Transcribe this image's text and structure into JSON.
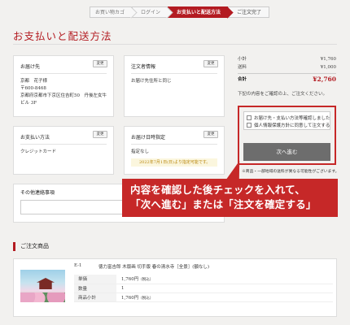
{
  "stepper": {
    "steps": [
      {
        "label": "お買い物カゴ"
      },
      {
        "label": "ログイン"
      },
      {
        "label": "お支払いと配送方法"
      },
      {
        "label": "ご注文完了"
      }
    ]
  },
  "page_title": "お支払いと配送方法",
  "cards": {
    "delivery_to": {
      "title": "お届け先",
      "change_label": "変更",
      "lines": [
        "京都　花子様",
        "〒600-8468",
        "京都府京都市下京区住吉町50　丹後左女牛",
        "ビル 3F"
      ]
    },
    "orderer": {
      "title": "注文者情報",
      "change_label": "変更",
      "body": "お届け先住所と同じ"
    },
    "payment": {
      "title": "お支払い方法",
      "change_label": "変更",
      "body": "クレジットカード"
    },
    "delivery_date": {
      "title": "お届け日時指定",
      "change_label": "変更",
      "body": "指定なし",
      "note": "2022年7月1日(日)より指定可能です。"
    },
    "other": {
      "title": "その他連絡事項"
    }
  },
  "summary": {
    "rows": [
      {
        "label": "小計",
        "amount": "¥1,760"
      },
      {
        "label": "送料",
        "amount": "¥1,000"
      }
    ],
    "total_label": "合計",
    "total_amount": "¥2,760",
    "description": "下記の内容をご確認の上、ご注文ください。",
    "checks": [
      "お届け先・支払い方法等確認しました",
      "個人情報保護方針に同意して注文する"
    ],
    "next_button": "次へ進む",
    "note": "※商品・一部地域の送料が異なる可能性がございます。"
  },
  "callout": {
    "line1": "内容を確認した後チェックを入れて、",
    "line2": "「次へ進む」または「注文を確定する」"
  },
  "products": {
    "section_title": "ご注文商品",
    "item": {
      "code": "E-1",
      "name": "徳力富吉郎 木版画 切手版 春の清水寺［全景］(額なし)",
      "rows": [
        {
          "key": "単価",
          "value": "1,760円",
          "suffix": "（税込）"
        },
        {
          "key": "数量",
          "value": "1",
          "suffix": ""
        },
        {
          "key": "商品小計",
          "value": "1,760円",
          "suffix": "（税込）"
        }
      ]
    }
  },
  "colors": {
    "accent": "#b31b21",
    "callout": "#c62828",
    "next_button": "#6d6d6d",
    "background": "#f2f1ef"
  }
}
